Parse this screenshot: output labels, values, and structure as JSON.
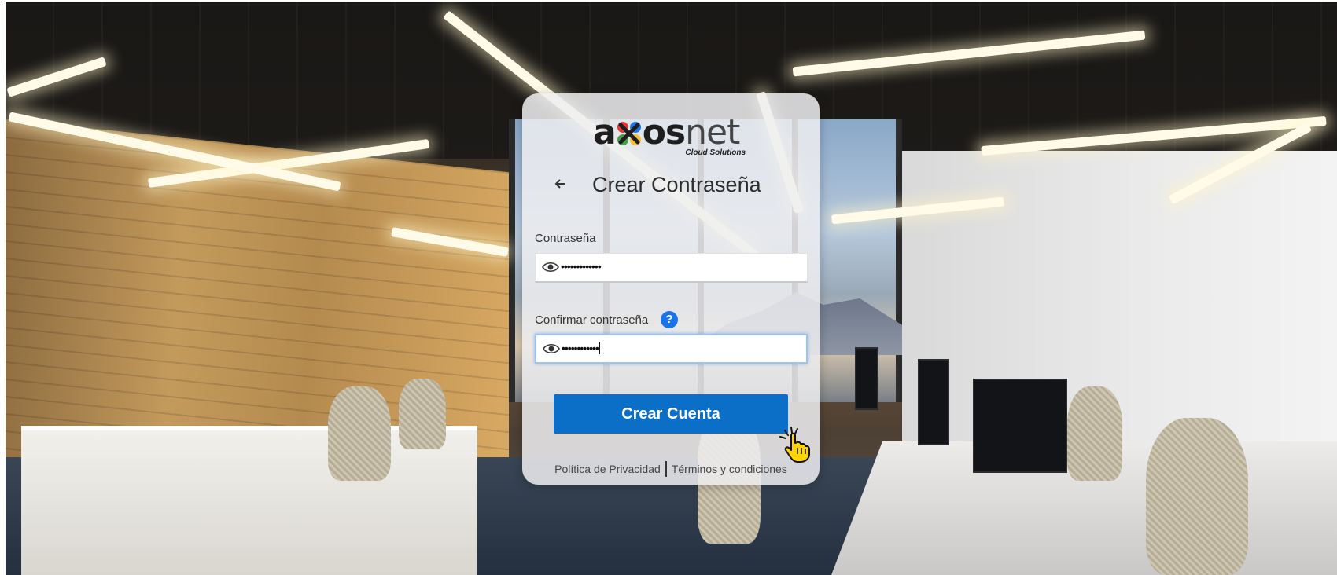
{
  "logo": {
    "wordmark_a": "a",
    "wordmark_os": "os",
    "wordmark_net": "net",
    "tagline": "Cloud Solutions"
  },
  "header": {
    "back_icon": "arrow-left-icon",
    "title": "Crear Contraseña"
  },
  "form": {
    "password_label": "Contraseña",
    "password_value": "•••••••••••••",
    "confirm_label": "Confirmar contraseña",
    "confirm_help_icon": "question-icon",
    "confirm_help_text": "?",
    "confirm_value": "••••••••••••",
    "eye_icon": "eye-icon",
    "submit_label": "Crear Cuenta"
  },
  "footer": {
    "privacy_link": "Política de Privacidad",
    "terms_link": "Términos y condiciones"
  },
  "colors": {
    "primary_button": "#0b6fc7",
    "help_badge": "#1a73e8",
    "logo_x_red": "#e53935",
    "logo_x_blue": "#1e73e8",
    "logo_x_green": "#43a047",
    "logo_x_yellow": "#fbc02d"
  },
  "cursor_icon": "hand-pointer-icon"
}
